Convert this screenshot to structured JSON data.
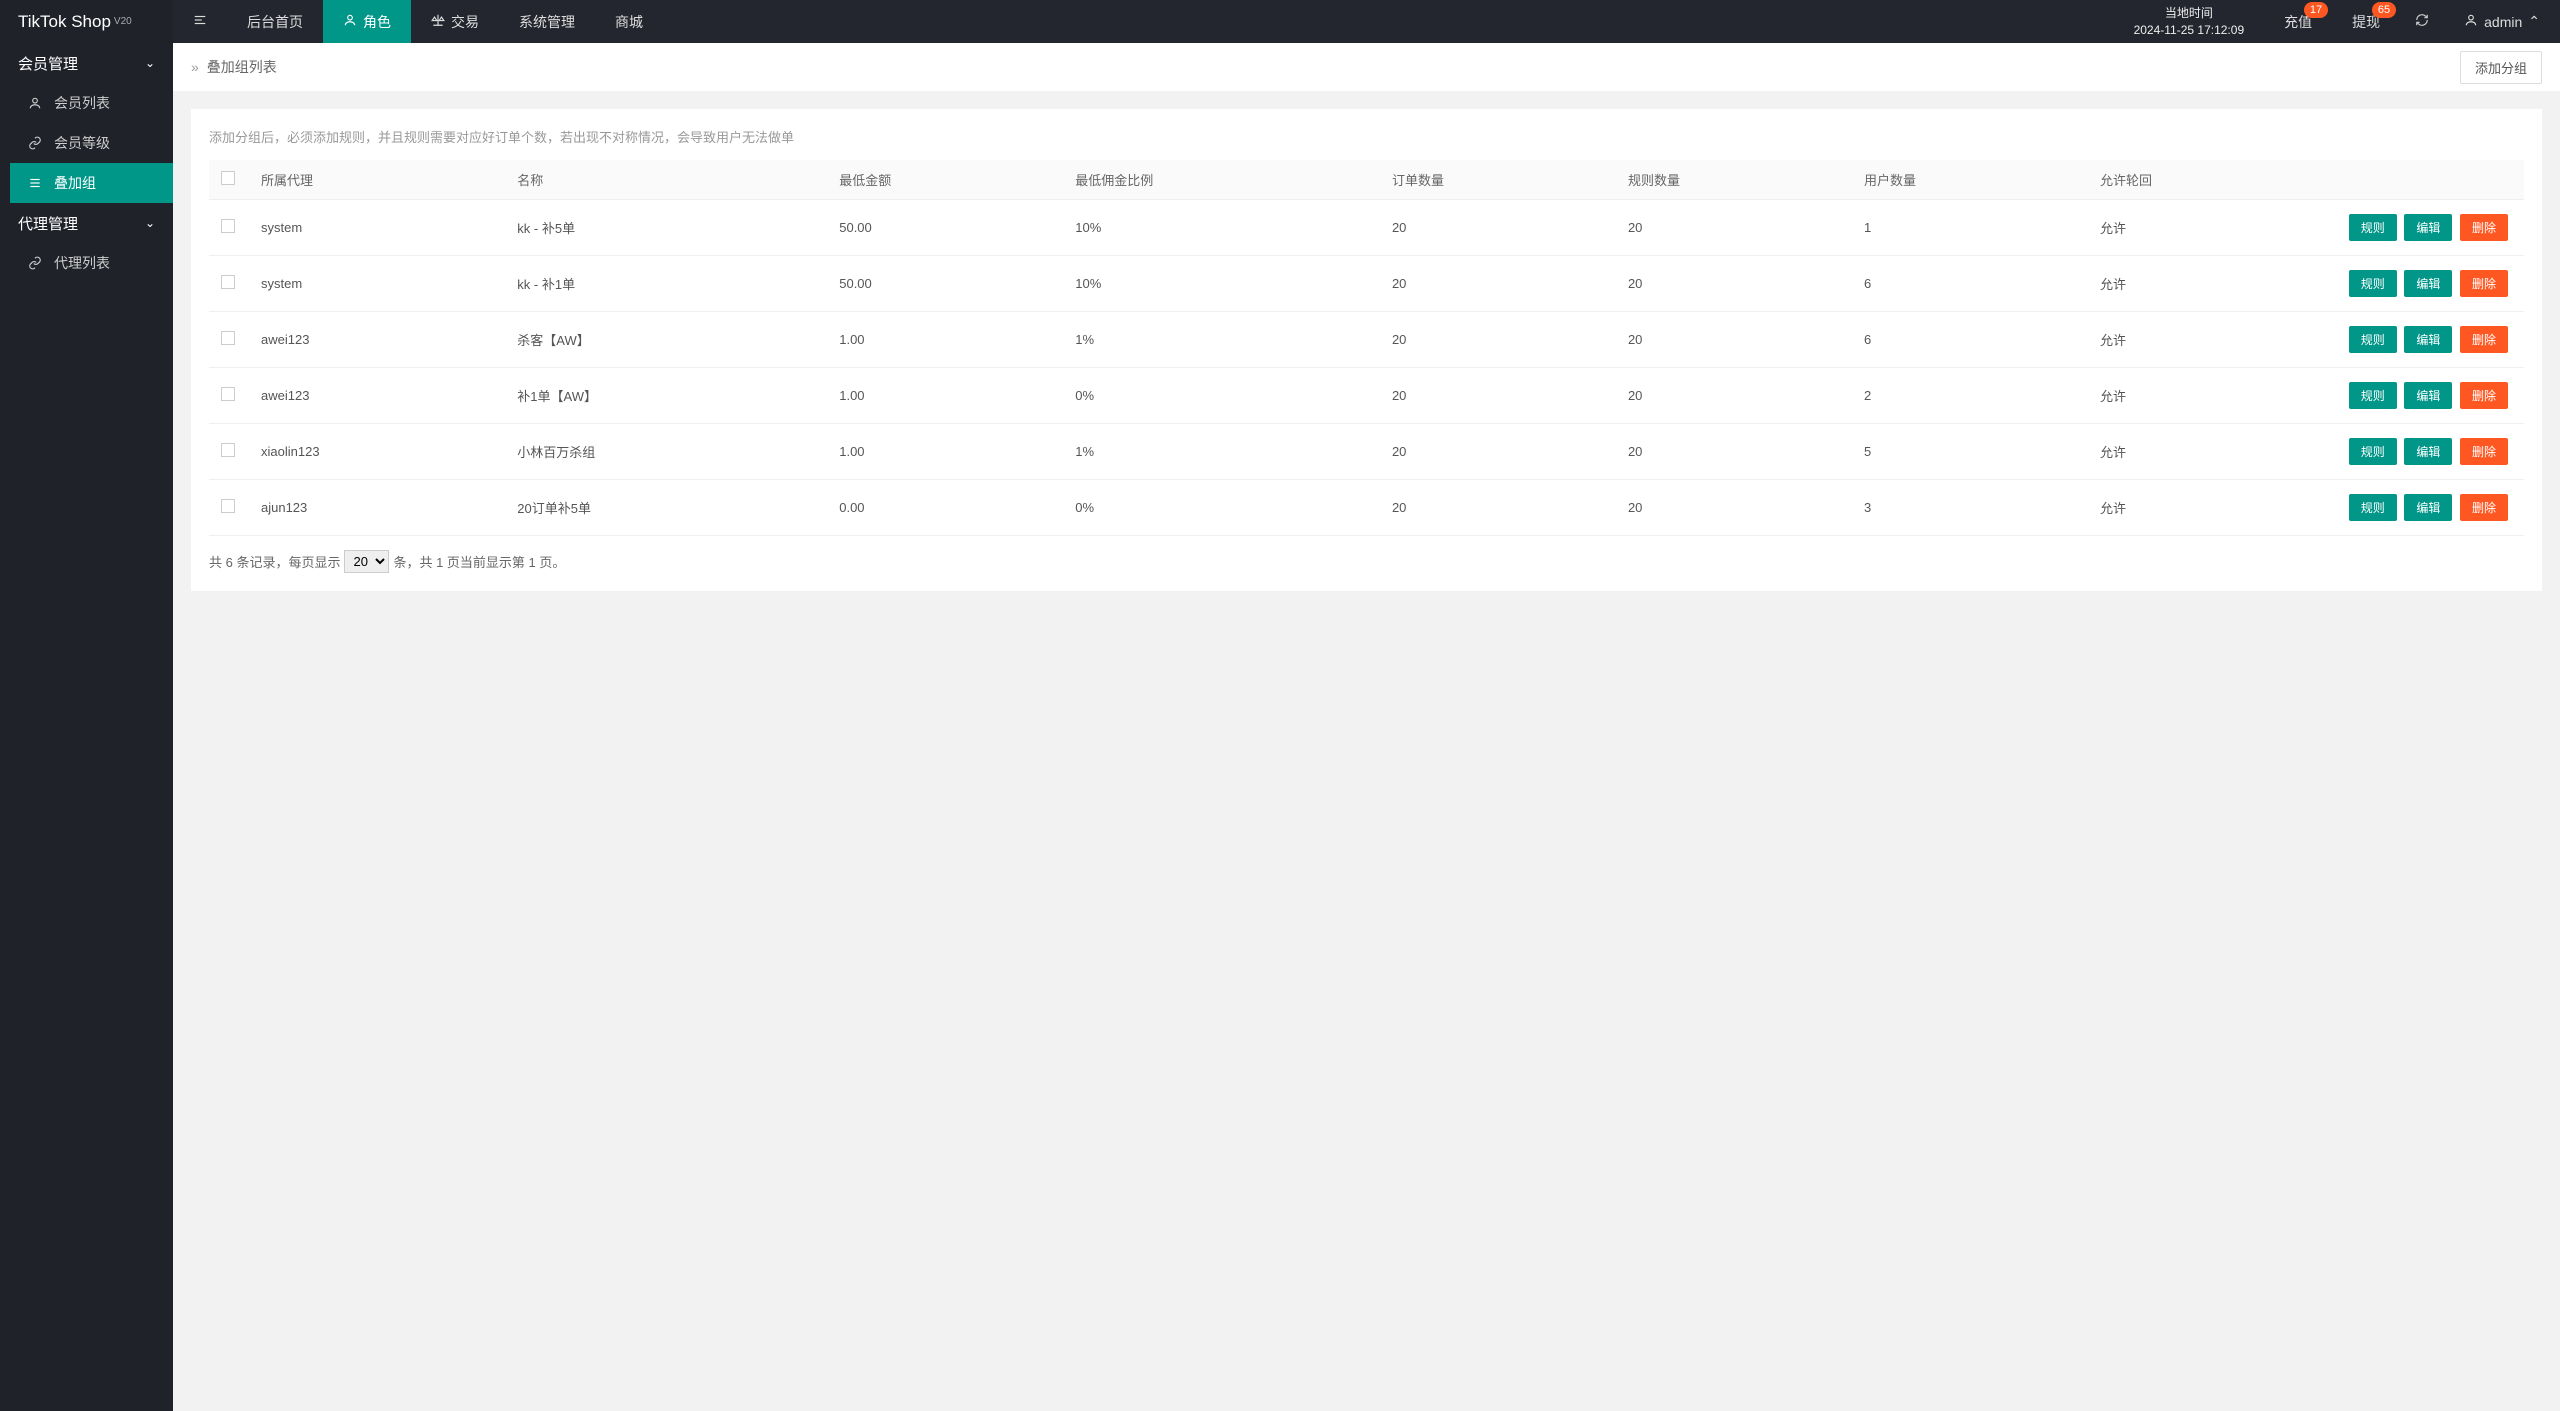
{
  "brand": {
    "name": "TikTok Shop",
    "version": "V20"
  },
  "sidebar": {
    "group1": {
      "title": "会员管理",
      "items": [
        {
          "label": "会员列表"
        },
        {
          "label": "会员等级"
        },
        {
          "label": "叠加组"
        }
      ]
    },
    "group2": {
      "title": "代理管理",
      "items": [
        {
          "label": "代理列表"
        }
      ]
    }
  },
  "topnav": {
    "items": [
      {
        "label": "后台首页"
      },
      {
        "label": "角色"
      },
      {
        "label": "交易"
      },
      {
        "label": "系统管理"
      },
      {
        "label": "商城"
      }
    ],
    "time_label": "当地时间",
    "time_value": "2024-11-25 17:12:09",
    "recharge": {
      "label": "充值",
      "badge": "17"
    },
    "withdraw": {
      "label": "提现",
      "badge": "65"
    },
    "user": "admin"
  },
  "page": {
    "title": "叠加组列表",
    "add_button": "添加分组",
    "notice": "添加分组后，必须添加规则，并且规则需要对应好订单个数，若出现不对称情况，会导致用户无法做单"
  },
  "table": {
    "headers": {
      "agent": "所属代理",
      "name": "名称",
      "min_amount": "最低金额",
      "min_ratio": "最低佣金比例",
      "order_count": "订单数量",
      "rule_count": "规则数量",
      "user_count": "用户数量",
      "allow_return": "允许轮回"
    },
    "actions": {
      "rule": "规则",
      "edit": "编辑",
      "delete": "删除"
    },
    "rows": [
      {
        "agent": "system",
        "name": "kk - 补5单",
        "min_amount": "50.00",
        "min_ratio": "10%",
        "order_count": "20",
        "rule_count": "20",
        "user_count": "1",
        "allow_return": "允许"
      },
      {
        "agent": "system",
        "name": "kk - 补1单",
        "min_amount": "50.00",
        "min_ratio": "10%",
        "order_count": "20",
        "rule_count": "20",
        "user_count": "6",
        "allow_return": "允许"
      },
      {
        "agent": "awei123",
        "name": "杀客【AW】",
        "min_amount": "1.00",
        "min_ratio": "1%",
        "order_count": "20",
        "rule_count": "20",
        "user_count": "6",
        "allow_return": "允许"
      },
      {
        "agent": "awei123",
        "name": "补1单【AW】",
        "min_amount": "1.00",
        "min_ratio": "0%",
        "order_count": "20",
        "rule_count": "20",
        "user_count": "2",
        "allow_return": "允许"
      },
      {
        "agent": "xiaolin123",
        "name": "小林百万杀组",
        "min_amount": "1.00",
        "min_ratio": "1%",
        "order_count": "20",
        "rule_count": "20",
        "user_count": "5",
        "allow_return": "允许"
      },
      {
        "agent": "ajun123",
        "name": "20订单补5单",
        "min_amount": "0.00",
        "min_ratio": "0%",
        "order_count": "20",
        "rule_count": "20",
        "user_count": "3",
        "allow_return": "允许"
      }
    ]
  },
  "pagination": {
    "prefix": "共 6 条记录，每页显示",
    "per_page": "20",
    "suffix": "条，共 1 页当前显示第 1 页。"
  }
}
